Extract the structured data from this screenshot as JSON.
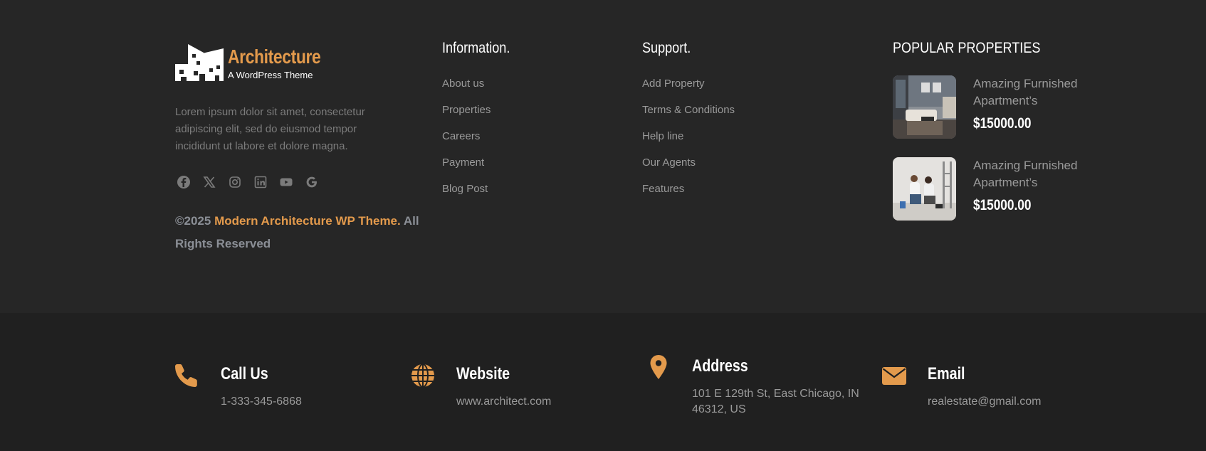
{
  "brand": {
    "title": "Architecture",
    "subtitle": "A WordPress Theme",
    "about": "Lorem ipsum dolor sit amet, consectetur adipiscing elit, sed do eiusmod tempor incididunt ut labore et dolore magna.",
    "accent_color": "#e39a4c"
  },
  "social": [
    {
      "icon": "facebook-icon"
    },
    {
      "icon": "x-twitter-icon"
    },
    {
      "icon": "instagram-icon"
    },
    {
      "icon": "linkedin-icon"
    },
    {
      "icon": "youtube-icon"
    },
    {
      "icon": "google-icon"
    }
  ],
  "copyright": {
    "year": "©2025 ",
    "brand": "Modern Architecture WP Theme.",
    "rest": " All Rights Reserved"
  },
  "information": {
    "heading": "Information.",
    "links": [
      "About us",
      "Properties",
      "Careers",
      "Payment",
      "Blog Post"
    ]
  },
  "support": {
    "heading": "Support.",
    "links": [
      "Add Property",
      "Terms & Conditions",
      "Help line",
      "Our Agents",
      "Features"
    ]
  },
  "popular": {
    "heading": "POPULAR PROPERTIES",
    "items": [
      {
        "title": "Amazing Furnished Apartment’s",
        "price": "$15000.00",
        "image": "living-room-photo"
      },
      {
        "title": "Amazing Furnished Apartment’s",
        "price": "$15000.00",
        "image": "couple-painting-photo"
      }
    ]
  },
  "contacts": [
    {
      "icon": "phone-icon",
      "title": "Call Us",
      "value": "1-333-345-6868"
    },
    {
      "icon": "globe-icon",
      "title": "Website",
      "value": "www.architect.com"
    },
    {
      "icon": "map-pin-icon",
      "title": "Address",
      "value": "101 E 129th St, East Chicago, IN 46312, US"
    },
    {
      "icon": "envelope-icon",
      "title": "Email",
      "value": "realestate@gmail.com"
    }
  ]
}
